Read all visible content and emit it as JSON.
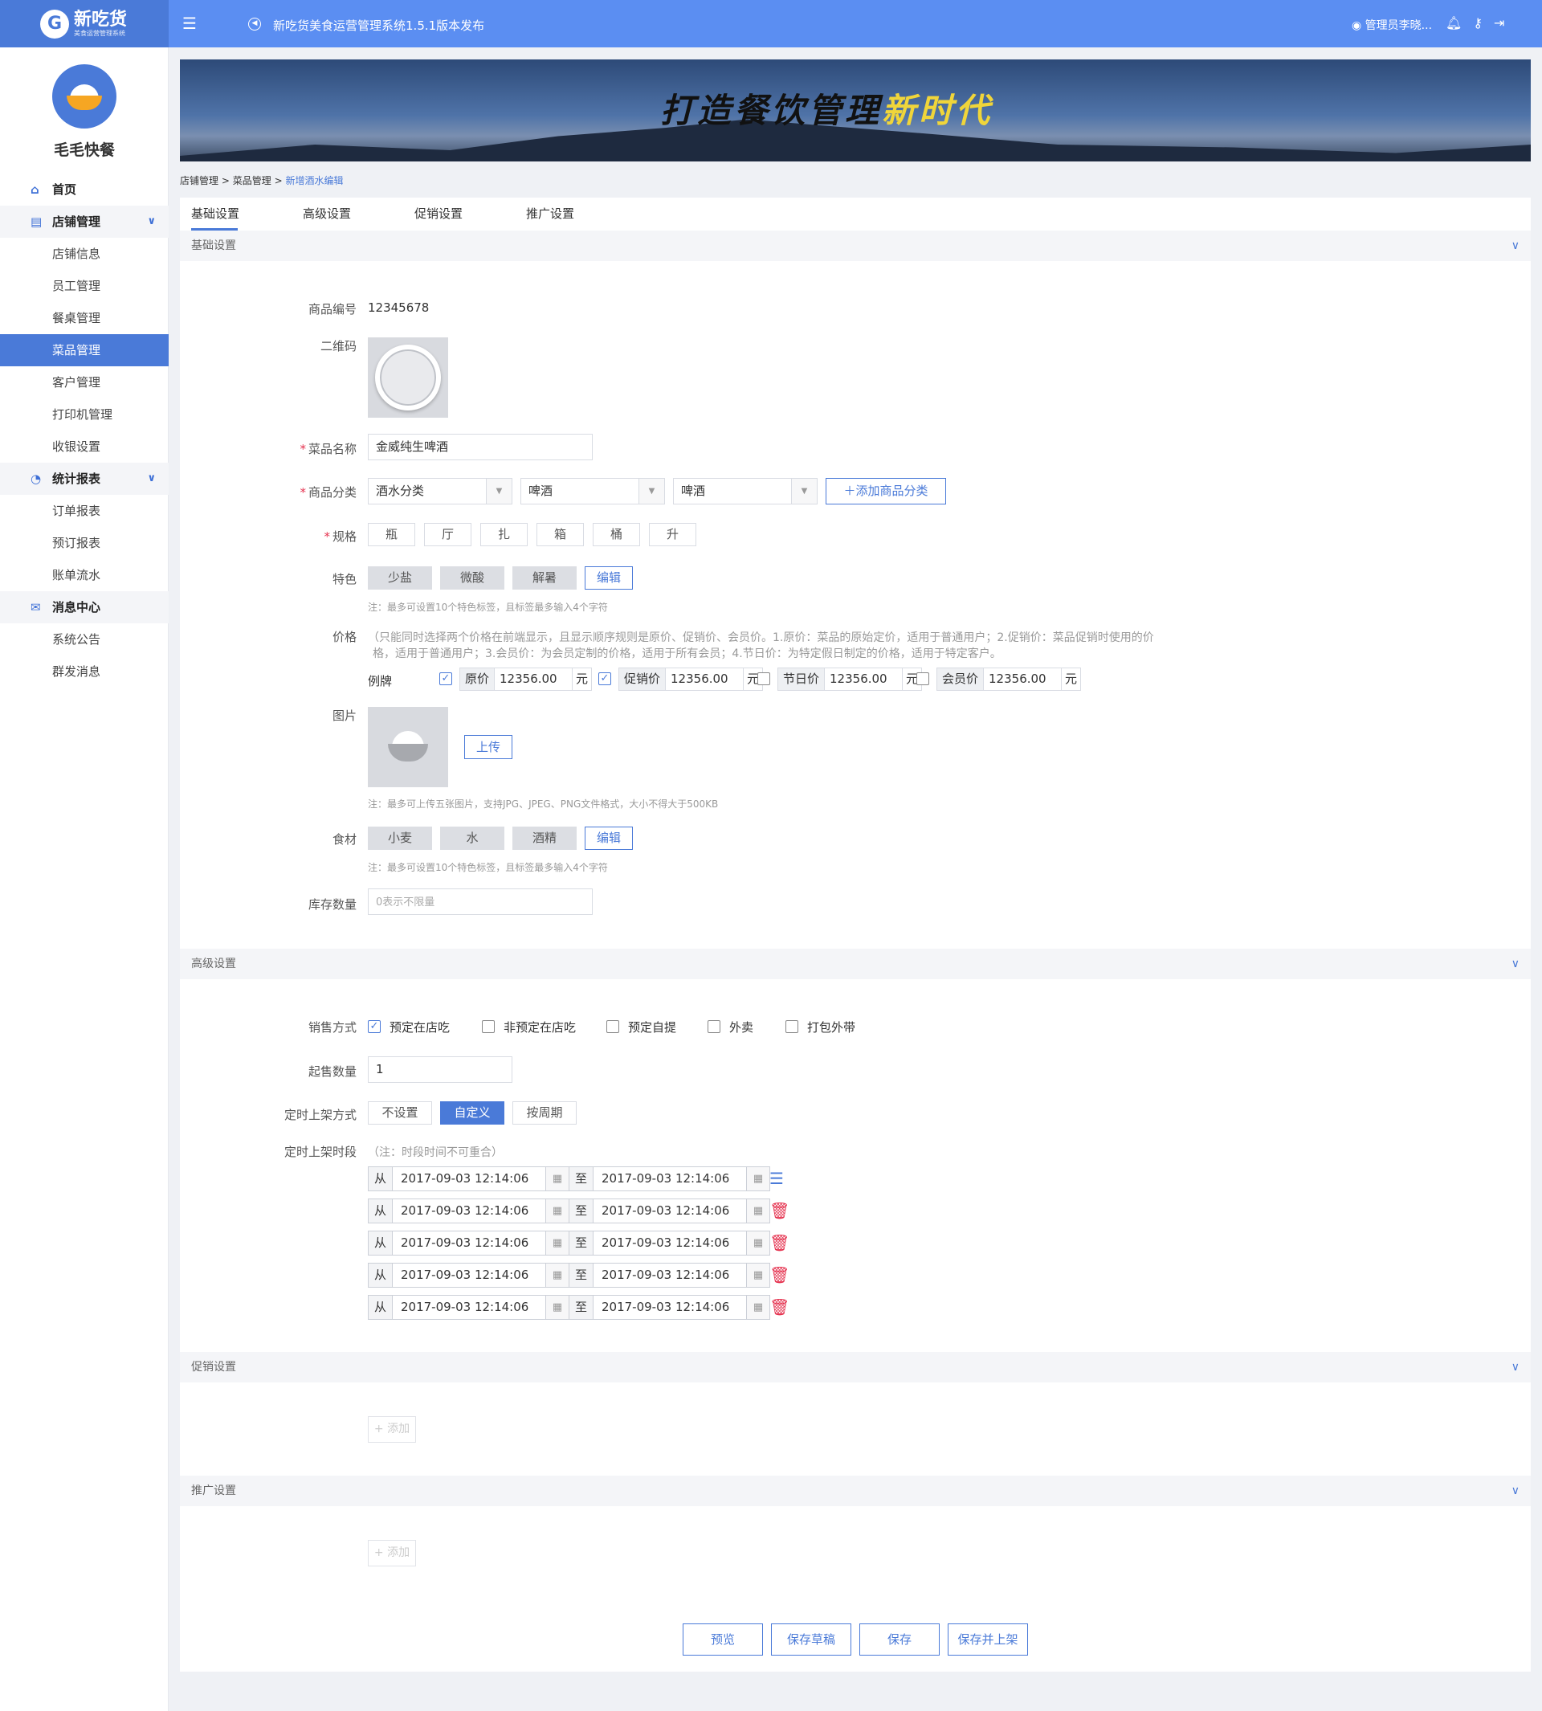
{
  "header": {
    "logo_title": "新吃货",
    "logo_sub": "美食运营管理系统",
    "notice": "新吃货美食运营管理系统1.5.1版本发布",
    "user": "管理员李晓..."
  },
  "sidebar": {
    "shop_name": "毛毛快餐",
    "items": [
      {
        "label": "首页",
        "kind": "home"
      },
      {
        "label": "店铺管理",
        "kind": "group"
      },
      {
        "label": "店铺信息"
      },
      {
        "label": "员工管理"
      },
      {
        "label": "餐桌管理"
      },
      {
        "label": "菜品管理",
        "active": true
      },
      {
        "label": "客户管理"
      },
      {
        "label": "打印机管理"
      },
      {
        "label": "收银设置"
      },
      {
        "label": "统计报表",
        "kind": "group"
      },
      {
        "label": "订单报表"
      },
      {
        "label": "预订报表"
      },
      {
        "label": "账单流水"
      },
      {
        "label": "消息中心",
        "kind": "group"
      },
      {
        "label": "系统公告"
      },
      {
        "label": "群发消息"
      }
    ]
  },
  "banner": {
    "slogan_dark": "打造餐饮管理",
    "slogan_gold": "新时代"
  },
  "breadcrumb": {
    "a": "店铺管理",
    "b": "菜品管理",
    "current": "新增酒水编辑",
    "sep": ">"
  },
  "tabs": [
    "基础设置",
    "高级设置",
    "促销设置",
    "推广设置"
  ],
  "basic": {
    "section": "基础设置",
    "code_label": "商品编号",
    "code": "12345678",
    "qr_label": "二维码",
    "name_label": "菜品名称",
    "name": "金威纯生啤酒",
    "cat_label": "商品分类",
    "cat1": "酒水分类",
    "cat2": "啤酒",
    "cat3": "啤酒",
    "add_cat": "添加商品分类",
    "spec_label": "规格",
    "specs": [
      "瓶",
      "厅",
      "扎",
      "箱",
      "桶",
      "升"
    ],
    "feature_label": "特色",
    "features": [
      "少盐",
      "微酸",
      "解暑"
    ],
    "edit": "编辑",
    "feature_note": "注：最多可设置10个特色标签，且标签最多输入4个字符",
    "price_label": "价格",
    "price_desc1": "（只能同时选择两个价格在前端显示，且显示顺序规则是原价、促销价、会员价。1.原价：菜品的原始定价，适用于普通用户；2.促销价：菜品促销时使用的价",
    "price_desc2": "格，适用于普通用户；3.会员价：为会员定制的价格，适用于所有会员；4.节日价：为特定假日制定的价格，适用于特定客户。",
    "example": "例牌",
    "prices": [
      {
        "name": "原价",
        "value": "12356.00",
        "checked": true
      },
      {
        "name": "促销价",
        "value": "12356.00",
        "checked": true
      },
      {
        "name": "节日价",
        "value": "12356.00",
        "checked": false
      },
      {
        "name": "会员价",
        "value": "12356.00",
        "checked": false
      }
    ],
    "unit": "元",
    "image_label": "图片",
    "upload": "上传",
    "image_note": "注：最多可上传五张图片，支持JPG、JPEG、PNG文件格式，大小不得大于500KB",
    "ingredient_label": "食材",
    "ingredients": [
      "小麦",
      "水",
      "酒精"
    ],
    "ingredient_note": "注：最多可设置10个特色标签，且标签最多输入4个字符",
    "stock_label": "库存数量",
    "stock_placeholder": "0表示不限量"
  },
  "advanced": {
    "section": "高级设置",
    "sale_label": "销售方式",
    "sale_modes": [
      {
        "label": "预定在店吃",
        "checked": true
      },
      {
        "label": "非预定在店吃",
        "checked": false
      },
      {
        "label": "预定自提",
        "checked": false
      },
      {
        "label": "外卖",
        "checked": false
      },
      {
        "label": "打包外带",
        "checked": false
      }
    ],
    "min_label": "起售数量",
    "min": "1",
    "sched_label": "定时上架方式",
    "sched_opts": [
      "不设置",
      "自定义",
      "按周期"
    ],
    "sched_selected": "自定义",
    "period_label": "定时上架时段",
    "period_note": "（注：时段时间不可重合）",
    "from": "从",
    "to": "至",
    "periods": [
      {
        "start": "2017-09-03  12:14:06",
        "end": "2017-09-03  12:14:06"
      },
      {
        "start": "2017-09-03  12:14:06",
        "end": "2017-09-03  12:14:06"
      },
      {
        "start": "2017-09-03  12:14:06",
        "end": "2017-09-03  12:14:06"
      },
      {
        "start": "2017-09-03  12:14:06",
        "end": "2017-09-03  12:14:06"
      },
      {
        "start": "2017-09-03  12:14:06",
        "end": "2017-09-03  12:14:06"
      }
    ]
  },
  "promo": {
    "section": "促销设置",
    "add": "+ 添加"
  },
  "spread": {
    "section": "推广设置",
    "add": "+ 添加"
  },
  "footer": {
    "preview": "预览",
    "draft": "保存草稿",
    "save": "保存",
    "publish": "保存并上架"
  },
  "colors": {
    "primary": "#4a7ad8",
    "topbar": "#5b8ef2",
    "required": "#e5324f",
    "delete": "#e5324f"
  }
}
